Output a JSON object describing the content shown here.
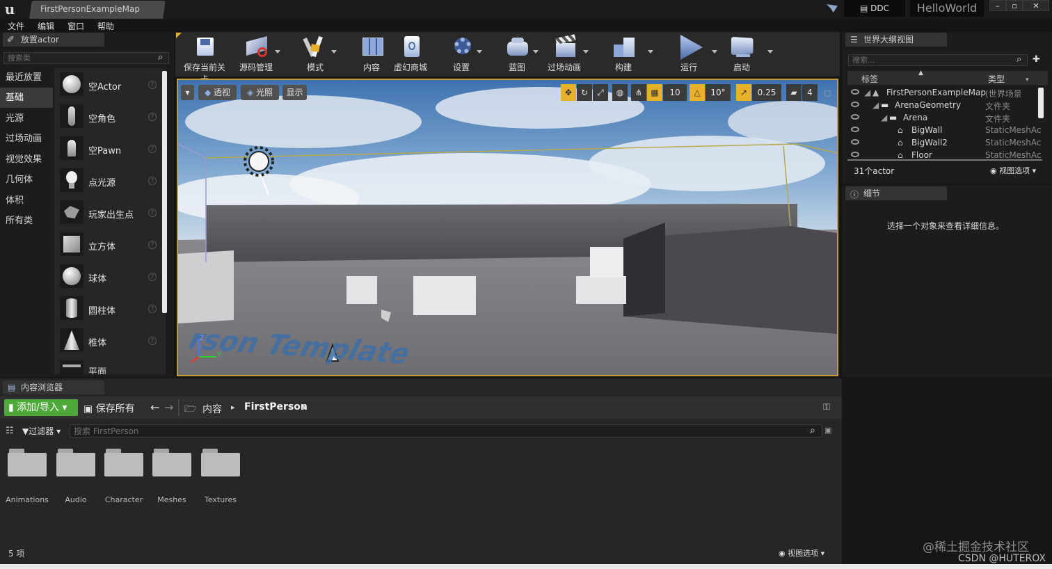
{
  "window": {
    "tab_title": "FirstPersonExampleMap",
    "ddc_label": "DDC",
    "project_name": "HelloWorld",
    "controls": [
      "–",
      "▫",
      "✕"
    ]
  },
  "menu": [
    "文件",
    "编辑",
    "窗口",
    "帮助"
  ],
  "place_actor": {
    "tab_label": "放置actor",
    "search_placeholder": "搜索类",
    "categories": [
      "最近放置",
      "基础",
      "光源",
      "过场动画",
      "视觉效果",
      "几何体",
      "体积",
      "所有类"
    ],
    "active_category": "基础",
    "items": [
      "空Actor",
      "空角色",
      "空Pawn",
      "点光源",
      "玩家出生点",
      "立方体",
      "球体",
      "圆柱体",
      "椎体",
      "平面"
    ]
  },
  "toolbar": [
    {
      "label": "保存当前关卡",
      "icon": "save-icon"
    },
    {
      "label": "源码管理",
      "icon": "source-control-icon"
    },
    {
      "label": "模式",
      "icon": "modes-icon"
    },
    {
      "label": "内容",
      "icon": "content-icon"
    },
    {
      "label": "虚幻商城",
      "icon": "marketplace-icon"
    },
    {
      "label": "设置",
      "icon": "settings-icon"
    },
    {
      "label": "蓝图",
      "icon": "blueprint-icon"
    },
    {
      "label": "过场动画",
      "icon": "cinematics-icon"
    },
    {
      "label": "构建",
      "icon": "build-icon"
    },
    {
      "label": "运行",
      "icon": "play-icon"
    },
    {
      "label": "启动",
      "icon": "launch-icon"
    }
  ],
  "viewport": {
    "perspective_label": "透视",
    "lit_label": "光照",
    "show_label": "显示",
    "grid_snap": "10",
    "rotation_snap": "10°",
    "scale_snap": "0.25",
    "camera_speed": "4",
    "floor_text": "rson Template",
    "axis_z": "Z",
    "axis_y": "Y"
  },
  "outliner": {
    "tab_label": "世界大纲视图",
    "search_placeholder": "搜索...",
    "col_label": "标签",
    "col_type": "类型",
    "rows": [
      {
        "label": "FirstPersonExampleMap",
        "type": "(世界场景"
      },
      {
        "label": "ArenaGeometry",
        "type": "文件夹"
      },
      {
        "label": "Arena",
        "type": "文件夹"
      },
      {
        "label": "BigWall",
        "type": "StaticMeshAc"
      },
      {
        "label": "BigWall2",
        "type": "StaticMeshAc"
      },
      {
        "label": "Floor",
        "type": "StaticMeshAc"
      }
    ],
    "actor_count": "31个actor",
    "view_options": "视图选项"
  },
  "details": {
    "tab_label": "细节",
    "empty_message": "选择一个对象来查看详细信息。"
  },
  "content_browser": {
    "tab_label": "内容浏览器",
    "add_import": "添加/导入",
    "save_all": "保存所有",
    "path_root": "内容",
    "path_current": "FirstPerson",
    "filters": "过滤器",
    "search_placeholder": "搜索 FirstPerson",
    "folders": [
      "Animations",
      "Audio",
      "Character",
      "Meshes",
      "Textures"
    ],
    "item_count": "5 项",
    "view_options": "视图选项"
  },
  "watermark": {
    "line1": "@稀土掘金技术社区",
    "line2": "CSDN @HUTEROX"
  },
  "colors": {
    "accent_yellow": "#e8b02b",
    "add_button_green": "#4ea93a",
    "panel_bg": "#1f1f1f",
    "toolbar_bg": "#2a2a2a",
    "sky_blue": "#5d8fc4"
  }
}
